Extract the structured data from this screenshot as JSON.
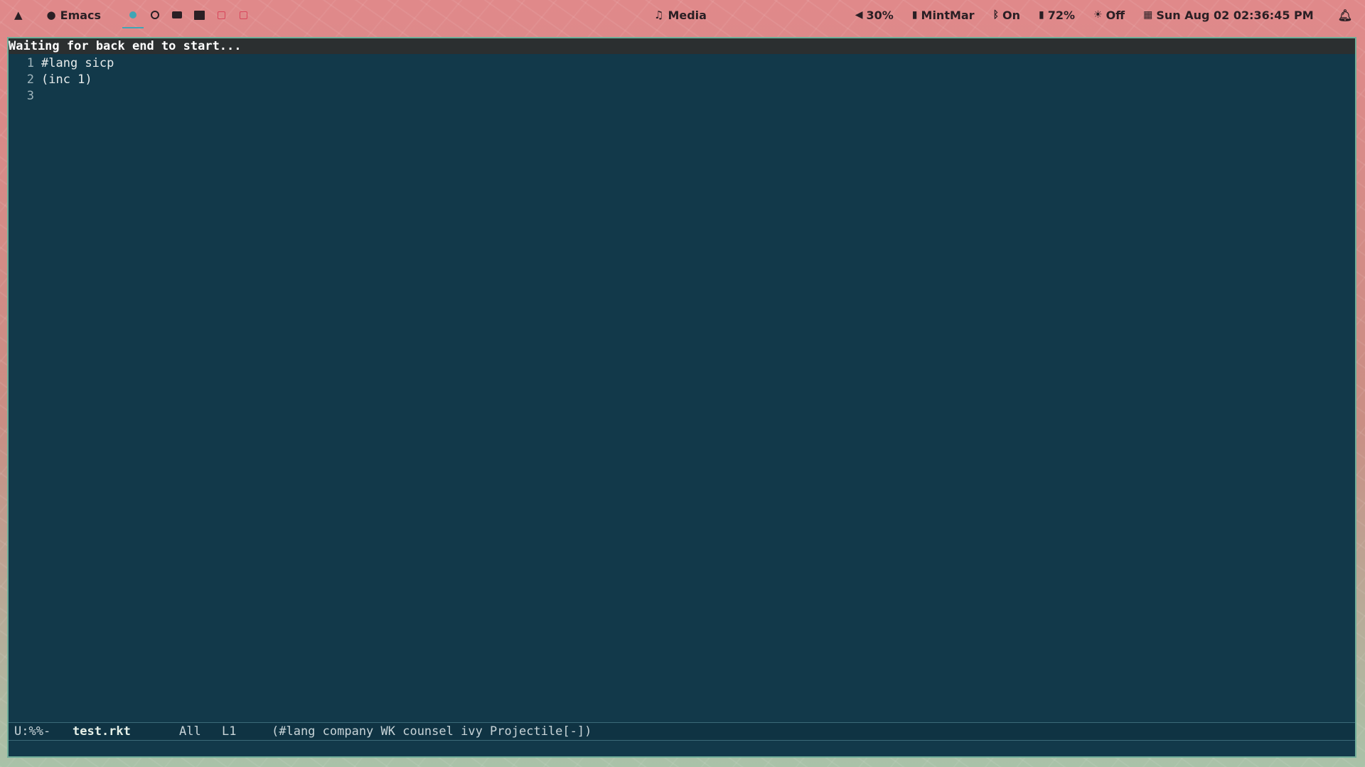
{
  "topbar": {
    "launcher_icon": "arch-logo-icon",
    "app_title": "Emacs",
    "workspaces": [
      {
        "name": "workspace-1",
        "active": true
      },
      {
        "name": "workspace-2",
        "active": false
      },
      {
        "name": "workspace-3",
        "active": false
      },
      {
        "name": "workspace-4",
        "active": false
      },
      {
        "name": "workspace-5",
        "active": false
      },
      {
        "name": "workspace-6",
        "active": false
      }
    ],
    "media_label": "Media",
    "volume": "30%",
    "network": "MintMar",
    "bluetooth": "On",
    "battery": "72%",
    "brightness": "Off",
    "datetime": "Sun Aug 02 02:36:45 PM"
  },
  "emacs": {
    "echo_message": "Waiting for back end to start...",
    "lines": [
      {
        "num": "1",
        "text": "#lang sicp"
      },
      {
        "num": "2",
        "text": "(inc 1)"
      },
      {
        "num": "3",
        "text": ""
      }
    ],
    "modeline": {
      "status": "U:%%-",
      "filename": "test.rkt",
      "position": "All",
      "line": "L1",
      "modes": "(#lang company WK counsel ivy Projectile[-])"
    }
  },
  "colors": {
    "bar_background": "#d98c86",
    "editor_background": "#12394a",
    "accent": "#3fa6b5"
  }
}
